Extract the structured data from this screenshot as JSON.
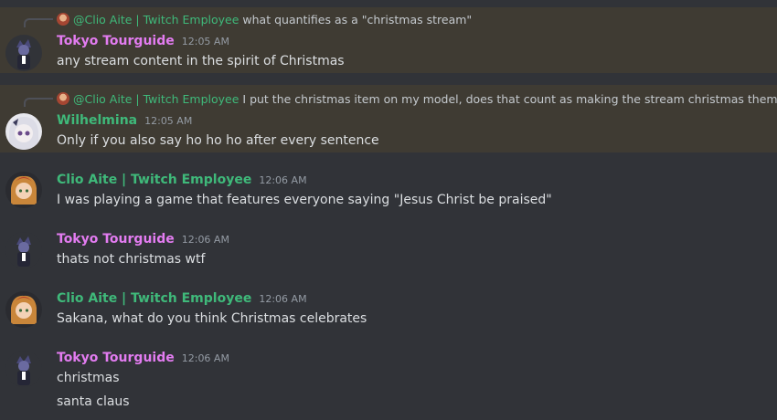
{
  "colors": {
    "background": "#313338",
    "mention_highlight": "#3f3b33",
    "tokyo_name": "#e37cf1",
    "clio_name": "#3fb97a",
    "wilhelmina_name": "#3fb97a",
    "timestamp": "#949ba4",
    "text": "#dbdee1"
  },
  "messages": [
    {
      "reply": {
        "name": "@Clio Aite | Twitch Employee",
        "text": "what quantifies as a \"christmas stream\""
      },
      "author": "Tokyo Tourguide",
      "time": "12:05 AM",
      "lines": [
        "any stream content in the spirit of Christmas"
      ]
    },
    {
      "reply": {
        "name": "@Clio Aite | Twitch Employee",
        "text": "I put the christmas item on my model, does that count as making the stream christmas themed"
      },
      "author": "Wilhelmina",
      "time": "12:05 AM",
      "lines": [
        "Only if you also say ho ho ho after every sentence"
      ]
    },
    {
      "author": "Clio Aite | Twitch Employee",
      "time": "12:06 AM",
      "lines": [
        "I was playing a game that features everyone saying \"Jesus Christ be praised\""
      ]
    },
    {
      "author": "Tokyo Tourguide",
      "time": "12:06 AM",
      "lines": [
        "thats not christmas wtf"
      ]
    },
    {
      "author": "Clio Aite | Twitch Employee",
      "time": "12:06 AM",
      "lines": [
        "Sakana, what do you think Christmas celebrates"
      ]
    },
    {
      "author": "Tokyo Tourguide",
      "time": "12:06 AM",
      "lines": [
        "christmas",
        "santa claus"
      ]
    }
  ]
}
